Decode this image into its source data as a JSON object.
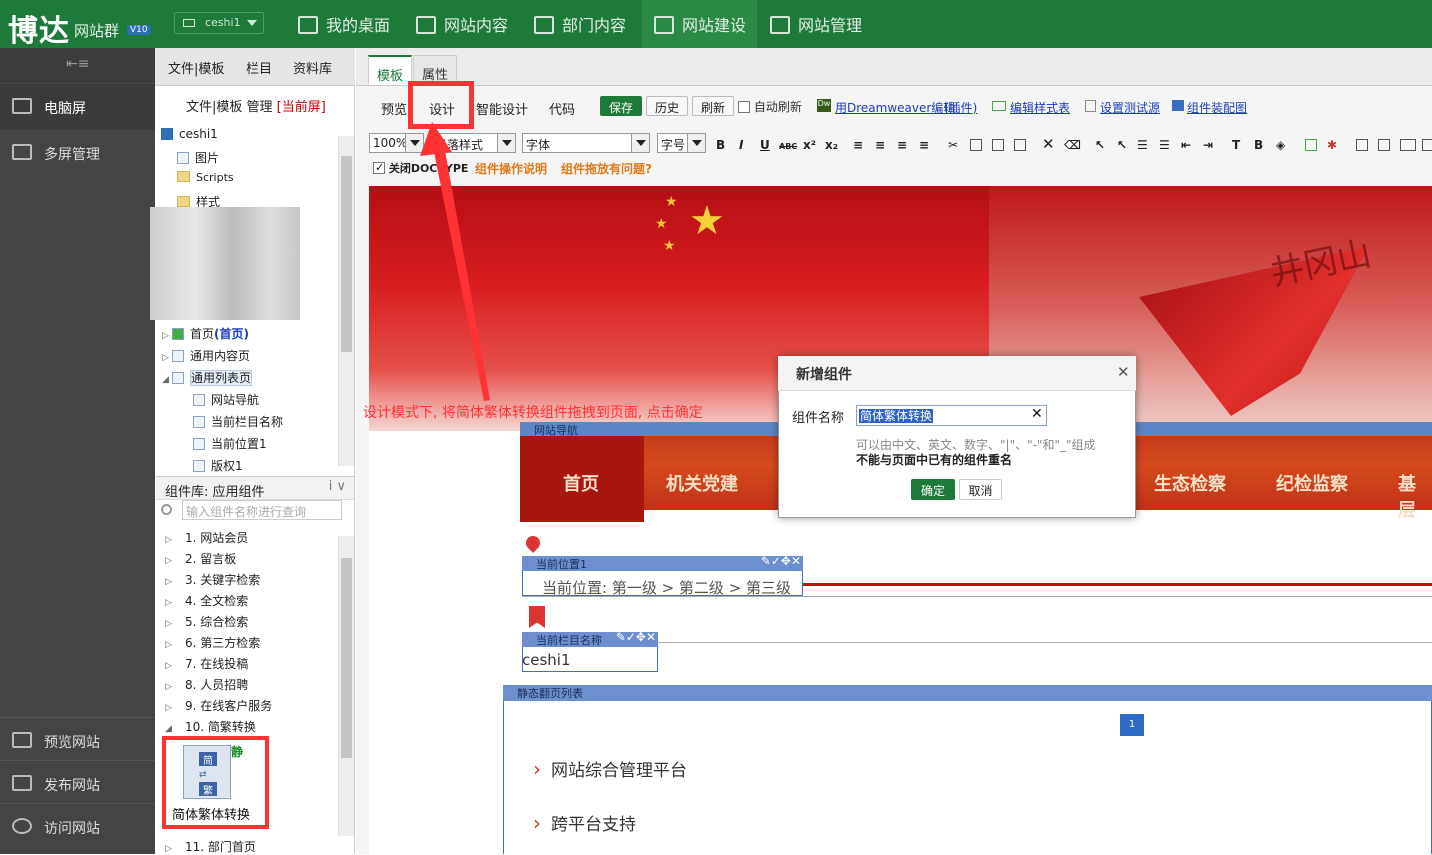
{
  "app": {
    "logo": "博达",
    "logo_sub": "网站群",
    "version": "V10",
    "site": "ceshi1"
  },
  "colors": {
    "brand": "#1d7a3a",
    "annotation": "#ff3333",
    "link": "#1a3dbd"
  },
  "nav": [
    {
      "label": "我的桌面",
      "icon": "desktop-icon"
    },
    {
      "label": "网站内容",
      "icon": "edit-icon"
    },
    {
      "label": "部门内容",
      "icon": "org-icon"
    },
    {
      "label": "网站建设",
      "icon": "build-icon",
      "active": true
    },
    {
      "label": "网站管理",
      "icon": "manage-icon"
    }
  ],
  "left_sidebar": {
    "top": [
      {
        "label": "电脑屏"
      },
      {
        "label": "多屏管理"
      }
    ],
    "bottom": [
      {
        "label": "预览网站"
      },
      {
        "label": "发布网站"
      },
      {
        "label": "访问网站"
      }
    ]
  },
  "tree_panel": {
    "tabs": [
      "文件|模板",
      "栏目",
      "资料库"
    ],
    "header": "文件|模板 管理",
    "header_tag": "[当前屏]",
    "nodes": [
      "ceshi1",
      "图片",
      "Scripts",
      "样式",
      "首页",
      "(首页)",
      "通用内容页",
      "通用列表页",
      "网站导航",
      "当前栏目名称",
      "当前位置1",
      "版权1"
    ]
  },
  "components": {
    "header": "组件库: 应用组件",
    "search_placeholder": "输入组件名称进行查询",
    "items": [
      "1. 网站会员",
      "2. 留言板",
      "3. 关键字检索",
      "4. 全文检索",
      "5. 综合检索",
      "6. 第三方检索",
      "7. 在线投稿",
      "8. 人员招聘",
      "9. 在线客户服务",
      "10. 简繁转换",
      "11. 部门首页"
    ],
    "dragged": {
      "label": "简体繁体转换",
      "static": "静",
      "icon_top": "简",
      "icon_bottom": "繁"
    }
  },
  "editor": {
    "tabs": [
      "模板",
      "属性"
    ],
    "modes": [
      "预览",
      "设计",
      "智能设计",
      "代码"
    ],
    "buttons": [
      "保存",
      "历史",
      "刷新"
    ],
    "auto_refresh": "自动刷新",
    "links": [
      "用Dreamweaver编辑",
      "(插件)",
      "编辑样式表",
      "设置测试源",
      "组件装配图"
    ],
    "zoom": "100%",
    "para_style": "段落样式",
    "font": "字体",
    "size": "字号",
    "close_doctype": "关闭DOCTYPE",
    "help1": "组件操作说明",
    "help2": "组件拖放有问题?"
  },
  "canvas": {
    "nav_comp": "网站导航",
    "nav_items": [
      "首页",
      "机关党建",
      "生态检察",
      "纪检监察",
      "基层"
    ],
    "loc_comp": "当前位置1",
    "loc_text": "当前位置: 第一级 > 第二级 > 第三级",
    "col_comp": "当前栏目名称",
    "col_text": "ceshi1",
    "list_comp": "静态翻页列表",
    "page_num": "1",
    "list_items": [
      "网站综合管理平台",
      "跨平台支持"
    ],
    "banner_text": "井冈山"
  },
  "instruction": "设计模式下, 将简体繁体转换组件拖拽到页面, 点击确定",
  "dialog": {
    "title": "新增组件",
    "label": "组件名称",
    "value": "简体繁体转换",
    "hint1": "可以由中文、英文、数字、\"|\"、\"-\"和\"_\"组成",
    "hint2": "不能与页面中已有的组件重名",
    "ok": "确定",
    "cancel": "取消"
  }
}
